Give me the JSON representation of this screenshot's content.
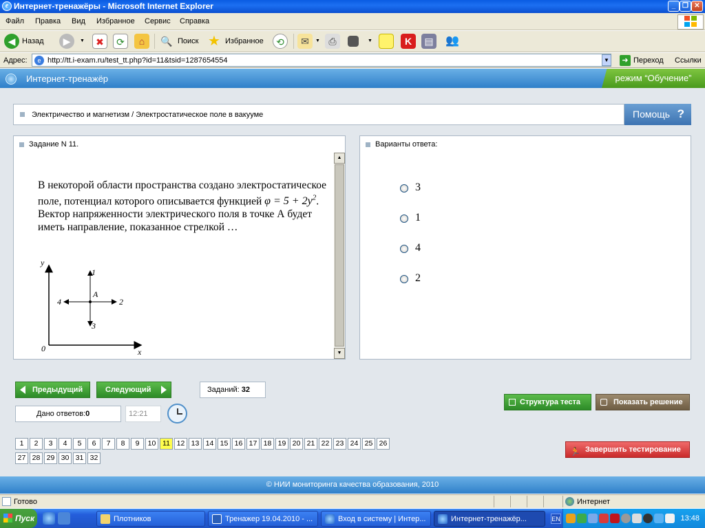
{
  "window": {
    "title": "Интернет-тренажёры - Microsoft Internet Explorer",
    "min": "_",
    "max": "❐",
    "close": "✕"
  },
  "menu": [
    "Файл",
    "Правка",
    "Вид",
    "Избранное",
    "Сервис",
    "Справка"
  ],
  "toolbar": {
    "back": "Назад",
    "search": "Поиск",
    "favorites": "Избранное"
  },
  "address": {
    "label": "Адрес:",
    "url": "http://tt.i-exam.ru/test_tt.php?id=11&tsid=1287654554",
    "go": "Переход",
    "links": "Ссылки"
  },
  "header": {
    "title": "Интернет-тренажёр",
    "mode": "режим “Обучение”"
  },
  "breadcrumb": "Электричество и магнетизм / Электростатическое поле в вакууме",
  "help": {
    "label": "Помощь",
    "icon": "?"
  },
  "question": {
    "heading": "Задание N 11.",
    "text1": "В некоторой области пространства создано электростатическое поле, потенциал которого описывается функцией",
    "formula": "φ = 5 + 2y",
    "formula_exp": "2",
    "text2": ". Вектор напряженности электрического поля в точке А будет иметь направление, показанное стрелкой …",
    "diagram": {
      "y": "y",
      "x": "x",
      "origin": "0",
      "point": "A",
      "a1": "1",
      "a2": "2",
      "a3": "3",
      "a4": "4"
    }
  },
  "answers": {
    "heading": "Варианты ответа:",
    "options": [
      "3",
      "1",
      "4",
      "2"
    ]
  },
  "nav": {
    "prev": "Предыдущий",
    "next": "Следующий",
    "tasks_label": "Заданий:",
    "tasks_count": "32",
    "answered_label": "Дано ответов:",
    "answered_count": "0",
    "timer": "12:21"
  },
  "actions": {
    "structure": "Структура теста",
    "show_solution": "Показать решение",
    "finish": "Завершить тестирование"
  },
  "pages": [
    "1",
    "2",
    "3",
    "4",
    "5",
    "6",
    "7",
    "8",
    "9",
    "10",
    "11",
    "12",
    "13",
    "14",
    "15",
    "16",
    "17",
    "18",
    "19",
    "20",
    "21",
    "22",
    "23",
    "24",
    "25",
    "26",
    "27",
    "28",
    "29",
    "30",
    "31",
    "32"
  ],
  "current_page": "11",
  "footer": "© НИИ мониторинга качества образования, 2010",
  "status": {
    "text": "Готово",
    "zone": "Интернет"
  },
  "taskbar": {
    "start": "Пуск",
    "tasks": [
      "Плотников",
      "Тренажер 19.04.2010 - ...",
      "Вход в систему | Интер...",
      "Интернет-тренажёр..."
    ],
    "lang": "EN",
    "clock": "13:48"
  },
  "colors": {
    "accent": "#2f7fc9",
    "green": "#3c9d2f",
    "current_page": "#fffd4d",
    "finish": "#c92b2b"
  }
}
